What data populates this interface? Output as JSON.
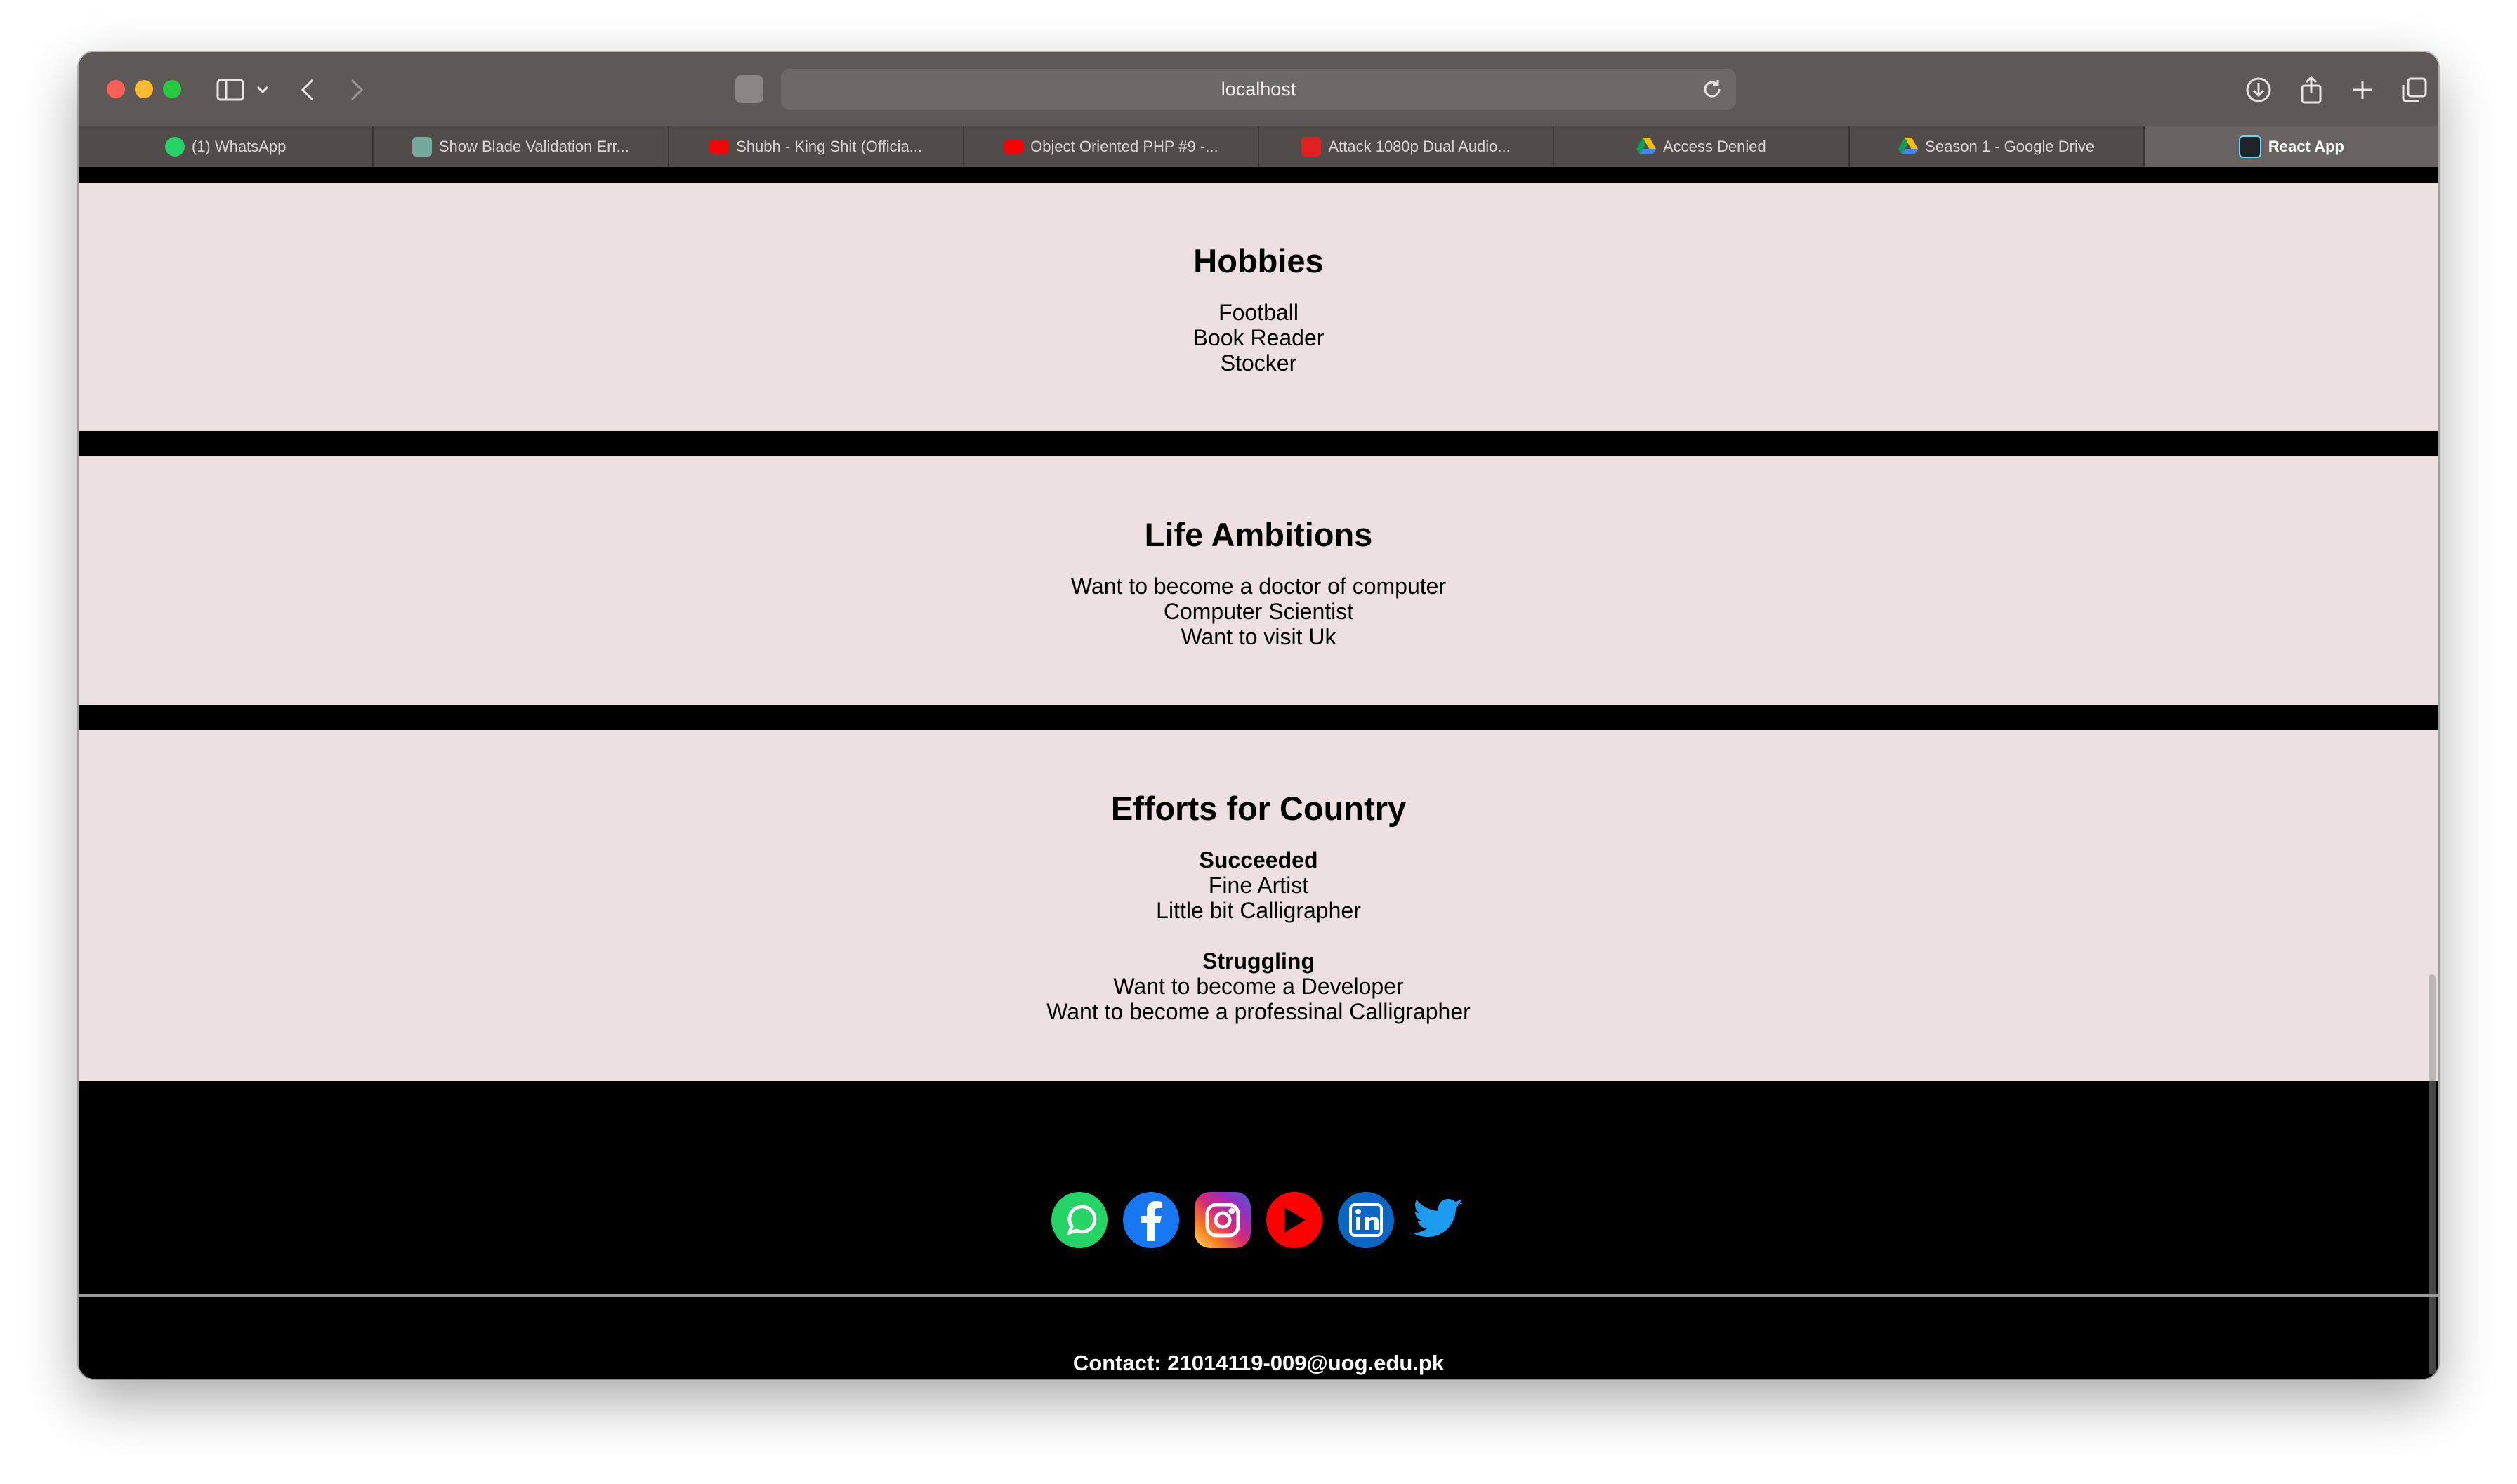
{
  "browser": {
    "url": "localhost",
    "tabs": [
      {
        "label": "(1) WhatsApp",
        "icon": "whatsapp-icon",
        "color": "#25d366"
      },
      {
        "label": "Show Blade Validation Err...",
        "icon": "chatgpt-icon",
        "color": "#74aa9c"
      },
      {
        "label": "Shubh - King Shit (Officia...",
        "icon": "youtube-icon",
        "color": "#ff0000"
      },
      {
        "label": "Object Oriented PHP #9 -...",
        "icon": "youtube-icon",
        "color": "#ff0000"
      },
      {
        "label": "Attack 1080p Dual Audio...",
        "icon": "ka-icon",
        "color": "#e02020"
      },
      {
        "label": "Access Denied",
        "icon": "google-drive-icon",
        "color": "#fbbc04"
      },
      {
        "label": "Season 1 - Google Drive",
        "icon": "google-drive-icon",
        "color": "#fbbc04"
      },
      {
        "label": "React App",
        "icon": "react-icon",
        "color": "#61dafb"
      }
    ]
  },
  "sections": {
    "hobbies": {
      "title": "Hobbies",
      "items": [
        "Football",
        "Book Reader",
        "Stocker"
      ]
    },
    "ambitions": {
      "title": "Life Ambitions",
      "items": [
        "Want to become a doctor of computer",
        "Computer Scientist",
        "Want to visit Uk"
      ]
    },
    "efforts": {
      "title": "Efforts for Country",
      "succeeded": {
        "heading": "Succeeded",
        "items": [
          "Fine Artist",
          "Little bit Calligrapher"
        ]
      },
      "struggling": {
        "heading": "Struggling",
        "items": [
          "Want to become a Developer",
          "Want to become a professinal Calligrapher"
        ]
      }
    }
  },
  "footer": {
    "social": [
      "whatsapp-icon",
      "facebook-icon",
      "instagram-icon",
      "youtube-icon",
      "linkedin-icon",
      "twitter-icon"
    ],
    "contact": "Contact: 21014119-009@uog.edu.pk"
  }
}
